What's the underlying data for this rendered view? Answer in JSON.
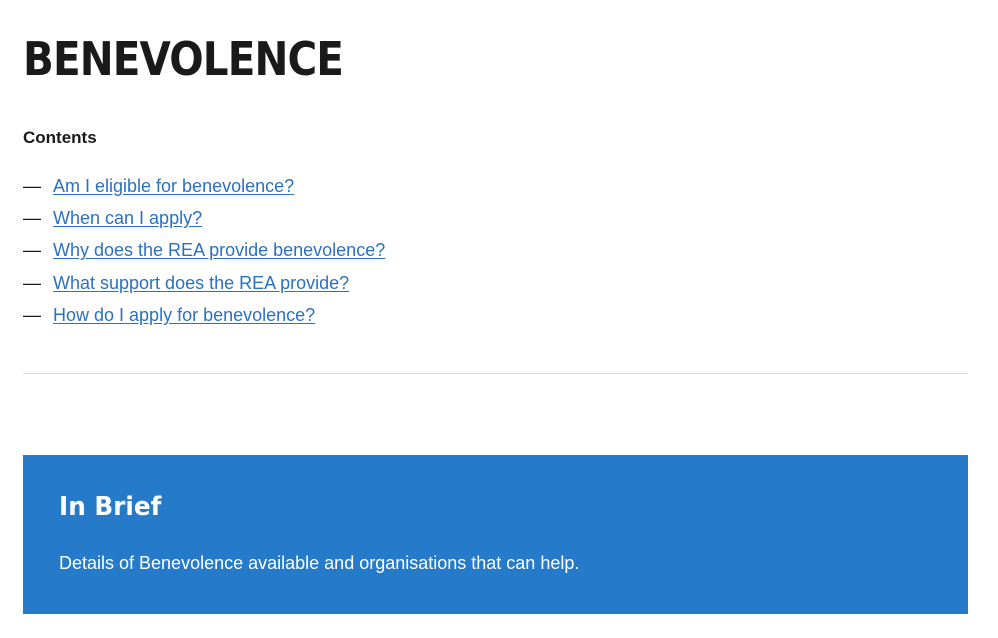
{
  "page": {
    "title": "BENEVOLENCE"
  },
  "contents": {
    "heading": "Contents",
    "dash": "—",
    "items": [
      {
        "label": "Am I eligible for benevolence?"
      },
      {
        "label": "When can I apply?"
      },
      {
        "label": "Why does the REA provide benevolence?"
      },
      {
        "label": "What support does the REA provide?"
      },
      {
        "label": "How do I apply for benevolence?"
      }
    ]
  },
  "brief": {
    "title": "In Brief",
    "text": "Details of Benevolence available and organisations that can help."
  },
  "colors": {
    "link": "#2a71c2",
    "brief_background": "#257bca",
    "divider": "#d8d8d8",
    "text": "#1a1a1a"
  }
}
